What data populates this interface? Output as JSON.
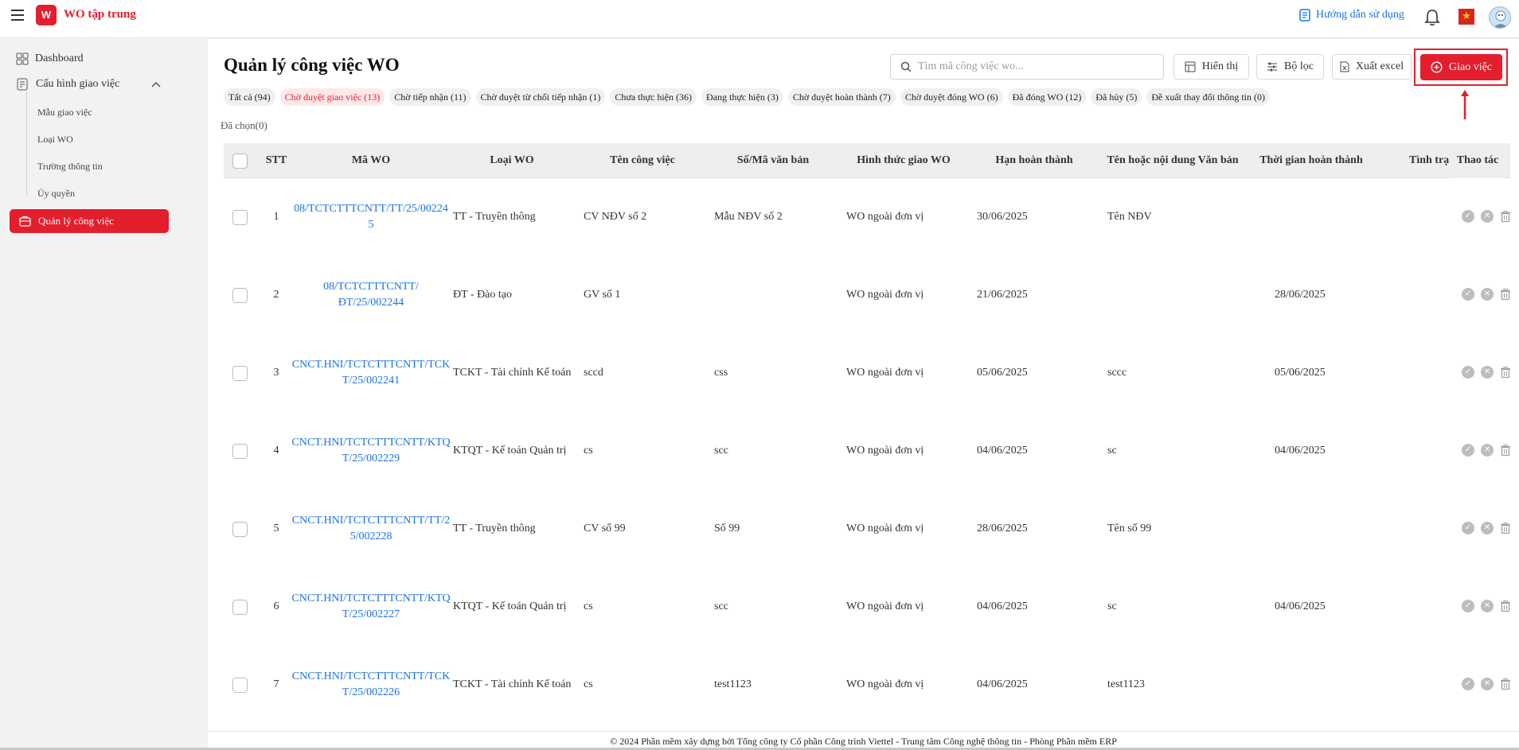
{
  "app": {
    "title": "WO tập trung",
    "logo_text": "W",
    "guide_label": "Hướng dẫn sử dụng",
    "flag_glyph": "★",
    "accent_color": "#e31e2d",
    "link_color": "#1a73e8"
  },
  "sidebar": {
    "dashboard": "Dashboard",
    "config_group": "Cấu hình giao việc",
    "sub_items": [
      "Mẫu giao việc",
      "Loại WO",
      "Trường thông tin",
      "Ủy quyền"
    ],
    "active_item": "Quản lý công việc"
  },
  "page": {
    "title": "Quản lý công việc WO",
    "search_placeholder": "Tìm mã công việc wo...",
    "display_label": "Hiển thị",
    "filter_label": "Bộ lọc",
    "export_label": "Xuất excel",
    "create_label": "Giao việc",
    "selected": "Đã chọn(0)"
  },
  "status_tabs": [
    "Tất cả (94)",
    "Chờ duyệt giao việc (13)",
    "Chờ tiếp nhận (11)",
    "Chờ duyệt từ chối tiếp nhận (1)",
    "Chưa thực hiện (36)",
    "Đang thực hiện (3)",
    "Chờ duyệt hoàn thành (7)",
    "Chờ duyệt đóng WO (6)",
    "Đã đóng WO (12)",
    "Đã hủy (5)",
    "Đề xuất thay đổi thông tin (0)"
  ],
  "active_status_tab": 1,
  "table": {
    "columns": [
      "STT",
      "Mã WO",
      "Loại WO",
      "Tên công việc",
      "Số/Mã văn bản",
      "Hình thức giao WO",
      "Hạn hoàn thành",
      "Tên hoặc nội dung Văn bản",
      "Thời gian hoàn thành",
      "Tình trạng",
      "Thao tác"
    ],
    "rows": [
      {
        "stt": "1",
        "ma_wo": [
          "08/TCTCTTTCNTT/TT/25/00224",
          "5"
        ],
        "loai": "TT - Truyền thông",
        "ten": "CV NĐV số 2",
        "so_vb": "Mẫu NĐV số 2",
        "hinh_thuc": "WO ngoài đơn vị",
        "han": "30/06/2025",
        "noi_dung": "Tên NĐV",
        "tg_hoan_thanh": ""
      },
      {
        "stt": "2",
        "ma_wo": [
          "08/TCTCTTTCNTT/",
          "ĐT/25/002244"
        ],
        "loai": "ĐT - Đào tạo",
        "ten": "GV số 1",
        "so_vb": "",
        "hinh_thuc": "WO ngoài đơn vị",
        "han": "21/06/2025",
        "noi_dung": "",
        "tg_hoan_thanh": "28/06/2025"
      },
      {
        "stt": "3",
        "ma_wo": [
          "CNCT.HNI/TCTCTTTCNTT/TCK",
          "T/25/002241"
        ],
        "loai": "TCKT - Tài chính Kế toán",
        "ten": "sccd",
        "so_vb": "css",
        "hinh_thuc": "WO ngoài đơn vị",
        "han": "05/06/2025",
        "noi_dung": "sccc",
        "tg_hoan_thanh": "05/06/2025"
      },
      {
        "stt": "4",
        "ma_wo": [
          "CNCT.HNI/TCTCTTTCNTT/KTQ",
          "T/25/002229"
        ],
        "loai": "KTQT - Kế toán Quản trị",
        "ten": "cs",
        "so_vb": "scc",
        "hinh_thuc": "WO ngoài đơn vị",
        "han": "04/06/2025",
        "noi_dung": "sc",
        "tg_hoan_thanh": "04/06/2025"
      },
      {
        "stt": "5",
        "ma_wo": [
          "CNCT.HNI/TCTCTTTCNTT/TT/2",
          "5/002228"
        ],
        "loai": "TT - Truyền thông",
        "ten": "CV số 99",
        "so_vb": "Số 99",
        "hinh_thuc": "WO ngoài đơn vị",
        "han": "28/06/2025",
        "noi_dung": "Tên số 99",
        "tg_hoan_thanh": ""
      },
      {
        "stt": "6",
        "ma_wo": [
          "CNCT.HNI/TCTCTTTCNTT/KTQ",
          "T/25/002227"
        ],
        "loai": "KTQT - Kế toán Quản trị",
        "ten": "cs",
        "so_vb": "scc",
        "hinh_thuc": "WO ngoài đơn vị",
        "han": "04/06/2025",
        "noi_dung": "sc",
        "tg_hoan_thanh": "04/06/2025"
      },
      {
        "stt": "7",
        "ma_wo": [
          "CNCT.HNI/TCTCTTTCNTT/TCK",
          "T/25/002226"
        ],
        "loai": "TCKT - Tài chính Kế toán",
        "ten": "cs",
        "so_vb": "test1123",
        "hinh_thuc": "WO ngoài đơn vị",
        "han": "04/06/2025",
        "noi_dung": "test1123",
        "tg_hoan_thanh": ""
      }
    ],
    "row_actions": [
      "approve-icon",
      "reject-icon",
      "trash-icon"
    ]
  },
  "footer": "© 2024 Phần mềm xây dựng bởi Tổng công ty Cổ phần Công trình Viettel - Trung tâm Công nghệ thông tin - Phòng Phần mềm ERP"
}
